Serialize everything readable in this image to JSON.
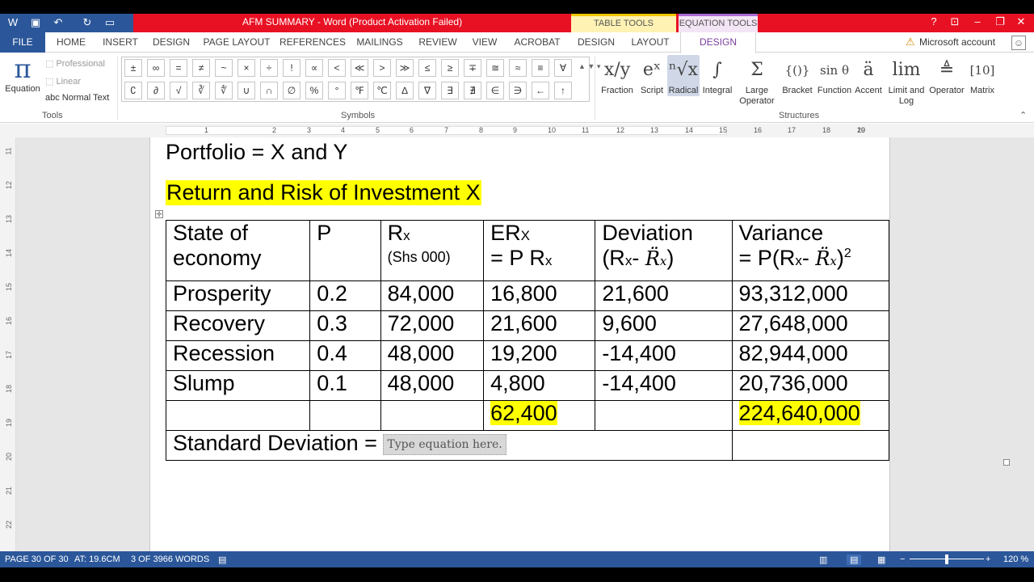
{
  "titlebar": {
    "doc_title": "AFM SUMMARY - Word (Product Activation Failed)",
    "table_tools": "TABLE TOOLS",
    "equation_tools": "EQUATION TOOLS"
  },
  "tabs": {
    "file": "FILE",
    "home": "HOME",
    "insert": "INSERT",
    "design": "DESIGN",
    "page_layout": "PAGE LAYOUT",
    "references": "REFERENCES",
    "mailings": "MAILINGS",
    "review": "REVIEW",
    "view": "VIEW",
    "acrobat": "ACROBAT",
    "table_design": "DESIGN",
    "table_layout": "LAYOUT",
    "eq_design": "DESIGN",
    "account": "Microsoft account"
  },
  "ribbon": {
    "equation": "Equation",
    "professional": "Professional",
    "linear": "Linear",
    "normal_text": "Normal Text",
    "tools_label": "Tools",
    "symbols_label": "Symbols",
    "structures_label": "Structures",
    "symbols_row1": [
      "±",
      "∞",
      "=",
      "≠",
      "~",
      "×",
      "÷",
      "!",
      "∝",
      "<",
      "≪",
      ">",
      "≫",
      "≤",
      "≥",
      "∓",
      "≅",
      "≈",
      "≡",
      "∀"
    ],
    "symbols_row2": [
      "∁",
      "∂",
      "√",
      "∛",
      "∜",
      "∪",
      "∩",
      "∅",
      "%",
      "°",
      "℉",
      "℃",
      "∆",
      "∇",
      "∃",
      "∄",
      "∈",
      "∋",
      "←",
      "↑"
    ],
    "structures": [
      "Fraction",
      "Script",
      "Radical",
      "Integral",
      "Large Operator",
      "Bracket",
      "Function",
      "Accent",
      "Limit and Log",
      "Operator",
      "Matrix"
    ]
  },
  "ruler": {
    "numbers": [
      "2",
      "1",
      "1",
      "2",
      "3",
      "4",
      "5",
      "6",
      "7",
      "8",
      "9",
      "10",
      "11",
      "12",
      "13",
      "14",
      "15",
      "16",
      "17",
      "18",
      "19",
      "20"
    ]
  },
  "vruler": {
    "numbers": [
      "11",
      "12",
      "13",
      "14",
      "15",
      "16",
      "17",
      "18",
      "19",
      "20",
      "21",
      "22"
    ]
  },
  "document": {
    "line1": "Portfolio = X and Y",
    "line2": "Return and Risk of Investment X",
    "table": {
      "h_state": "State of",
      "h_state2": "economy",
      "h_p": "P",
      "h_rx": "R",
      "h_rx_sub": "x",
      "h_rx_note": "(Shs 000)",
      "h_er": "ER",
      "h_er_sub": "X",
      "h_er2": "= P R",
      "h_er2_sub": "x",
      "h_dev": "Deviation",
      "h_dev2a": "(R",
      "h_dev2_sub": "x",
      "h_dev2b": "- ",
      "h_dev_rbar": "R̈",
      "h_dev_rbar_sub": "x",
      "h_dev2c": ")",
      "h_var": "Variance",
      "h_var2a": "= P(R",
      "h_var2_sub": "x",
      "h_var2b": "- ",
      "h_var_rbar": "R̈",
      "h_var_rbar_sub": "x",
      "h_var2c": ")",
      "h_var_sup": "2",
      "rows": [
        {
          "state": "Prosperity",
          "p": "0.2",
          "rx": "84,000",
          "er": "16,800",
          "dev": "21,600",
          "var": "93,312,000"
        },
        {
          "state": "Recovery",
          "p": "0.3",
          "rx": "72,000",
          "er": "21,600",
          "dev": "9,600",
          "var": "27,648,000"
        },
        {
          "state": "Recession",
          "p": "0.4",
          "rx": "48,000",
          "er": "19,200",
          "dev": "-14,400",
          "var": "82,944,000"
        },
        {
          "state": "Slump",
          "p": "0.1",
          "rx": "48,000",
          "er": "4,800",
          "dev": "-14,400",
          "var": "20,736,000"
        }
      ],
      "total_er": "62,400",
      "total_var": "224,640,000",
      "sd_label": "Standard Deviation =",
      "eq_placeholder": "Type equation here."
    }
  },
  "status": {
    "page": "PAGE 30 OF 30",
    "at": "AT: 19.6CM",
    "words": "3 OF 3966 WORDS",
    "zoom": "120 %"
  },
  "colors": {
    "word_blue": "#2b579a",
    "title_red": "#e81123",
    "highlight": "#ffff00"
  }
}
